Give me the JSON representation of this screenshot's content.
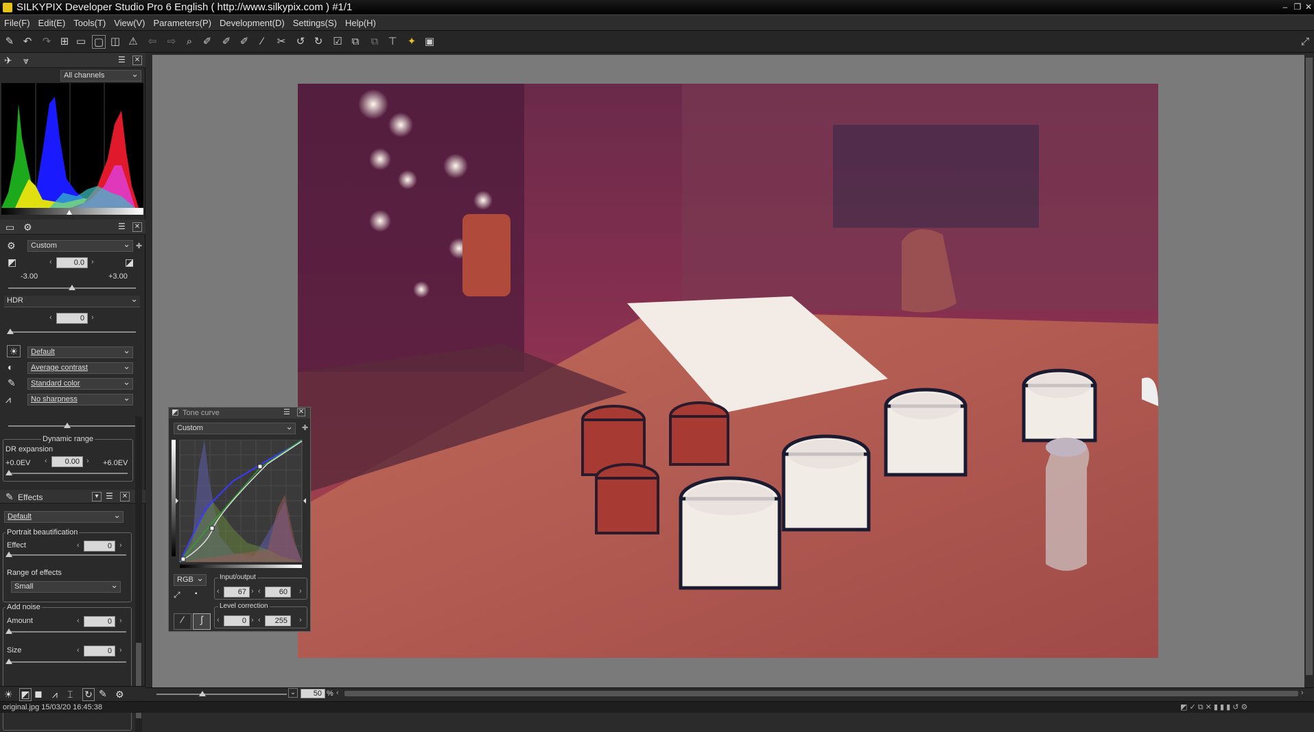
{
  "title": "SILKYPIX Developer Studio Pro 6 English ( http://www.silkypix.com )   #1/1",
  "menu": [
    "File(F)",
    "Edit(E)",
    "Tools(T)",
    "View(V)",
    "Parameters(P)",
    "Development(D)",
    "Settings(S)",
    "Help(H)"
  ],
  "histogram": {
    "channel": "All channels"
  },
  "develop": {
    "taste": "Custom",
    "exposure": {
      "value": "0.0",
      "min": "-3.00",
      "max": "+3.00"
    },
    "hdr": {
      "label": "HDR",
      "value": "0"
    },
    "white_balance": "Default",
    "contrast": "Average contrast",
    "color": "Standard color",
    "sharpness": "No sharpness",
    "dynamic_range": {
      "title": "Dynamic range",
      "label": "DR expansion",
      "value": "0.00",
      "min": "+0.0EV",
      "max": "+6.0EV"
    }
  },
  "effects": {
    "title": "Effects",
    "preset": "Default",
    "portrait": {
      "title": "Portrait beautification",
      "effect_label": "Effect",
      "effect_value": "0",
      "range_label": "Range of effects",
      "range_value": "Small"
    },
    "noise": {
      "title": "Add noise",
      "amount_label": "Amount",
      "amount_value": "0",
      "size_label": "Size",
      "size_value": "0"
    }
  },
  "tone_curve": {
    "title": "Tone curve",
    "preset": "Custom",
    "channel": "RGB",
    "io_label": "Input/output",
    "input": "67",
    "output": "60",
    "level_label": "Level correction",
    "level_low": "0",
    "level_high": "255"
  },
  "zoom": {
    "value": "50",
    "unit": "%"
  },
  "status": "original.jpg 15/03/20 16:45:38",
  "colors": {
    "accent": "#e6c21c"
  }
}
